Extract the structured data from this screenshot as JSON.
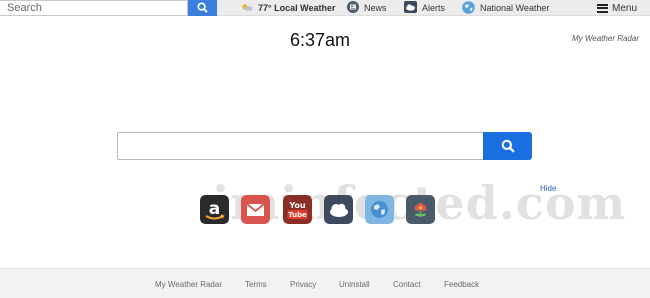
{
  "topbar": {
    "search_placeholder": "Search",
    "nav": {
      "weather": "77° Local Weather",
      "news": "News",
      "alerts": "Alerts",
      "national": "National Weather",
      "menu": "Menu"
    }
  },
  "clock": "6:37am",
  "brand": "My Weather Radar",
  "main_search": {
    "placeholder": "",
    "value": ""
  },
  "tiles": {
    "hide_label": "Hide",
    "items": [
      "amazon-icon",
      "gmail-icon",
      "youtube-icon",
      "weather-icon",
      "earth-icon",
      "flower-icon"
    ]
  },
  "watermark": "iminfected.com",
  "footer": {
    "links": [
      "My Weather Radar",
      "Terms",
      "Privacy",
      "Uninstall",
      "Contact",
      "Feedback"
    ]
  },
  "colors": {
    "accent": "#1a6fe0",
    "link": "#2b62c7"
  }
}
